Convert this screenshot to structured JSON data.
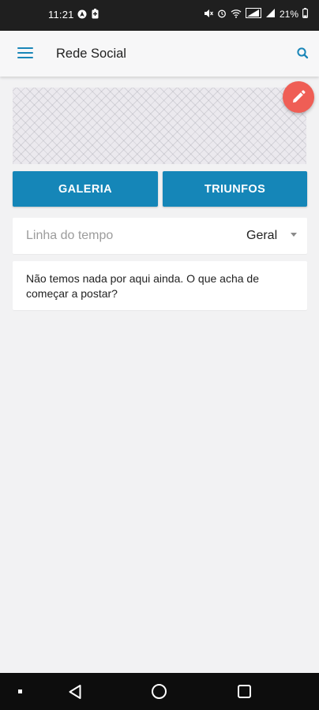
{
  "status_bar": {
    "time": "11:21",
    "battery": "21%",
    "icons": [
      "navigation-icon",
      "battery-saver-icon",
      "mute-icon",
      "alarm-icon",
      "wifi-icon",
      "signal-icon",
      "signal-icon",
      "battery-icon"
    ]
  },
  "app_bar": {
    "title": "Rede Social",
    "menu_icon": "hamburger-menu-icon",
    "search_icon": "search-icon"
  },
  "cover": {
    "edit_icon": "pencil-icon",
    "fab_color": "#ef5e55"
  },
  "actions": {
    "gallery_label": "GALERIA",
    "triumphs_label": "TRIUNFOS",
    "accent_color": "#1586b8"
  },
  "timeline": {
    "label": "Linha do tempo",
    "selected": "Geral"
  },
  "empty_state": {
    "message": "Não temos nada por aqui ainda. O que acha de começar a postar?"
  },
  "nav_bar": {
    "icons": [
      "back-icon",
      "home-icon",
      "recents-icon"
    ]
  }
}
